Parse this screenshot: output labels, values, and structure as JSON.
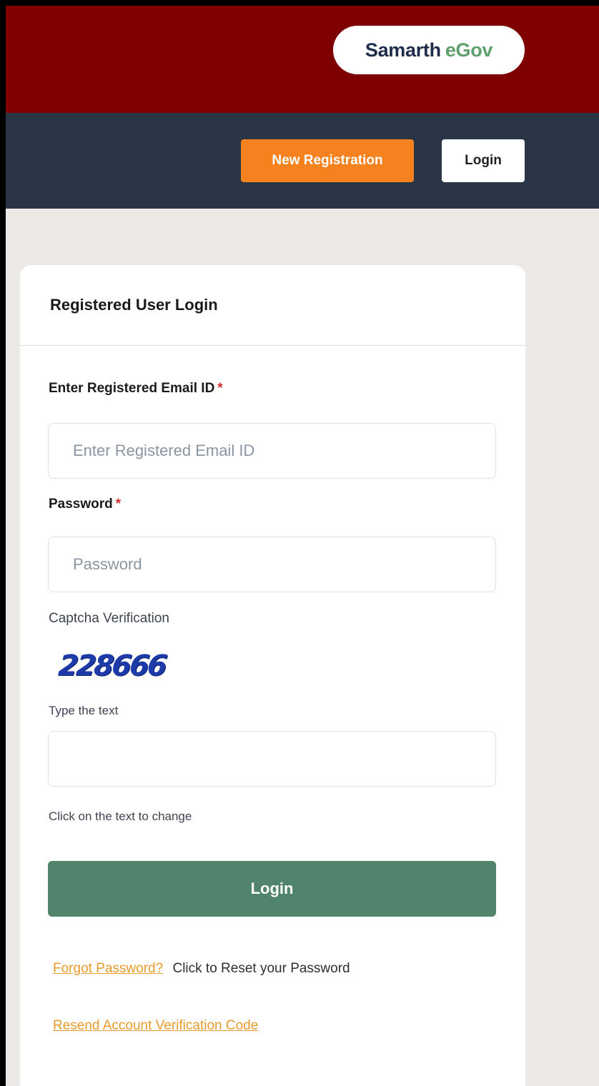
{
  "brand": {
    "part1": "Samarth",
    "part2": "eGov"
  },
  "nav": {
    "new_registration": "New Registration",
    "login": "Login"
  },
  "card": {
    "title": "Registered User Login",
    "email": {
      "label": "Enter Registered Email ID",
      "required_mark": "*",
      "placeholder": "Enter Registered Email ID",
      "value": ""
    },
    "password": {
      "label": "Password",
      "required_mark": "*",
      "placeholder": "Password",
      "value": ""
    },
    "captcha": {
      "heading": "Captcha Verification",
      "code": "228666",
      "input_label": "Type the text",
      "value": "",
      "hint": "Click on the text to change"
    },
    "submit_label": "Login",
    "forgot": {
      "link": "Forgot Password?",
      "text": "Click to Reset your Password"
    },
    "resend_link": "Resend Account Verification Code"
  },
  "colors": {
    "topbar": "#7f0000",
    "navbar": "#2a3546",
    "accent_orange": "#f5821f",
    "login_green": "#51846c",
    "link_orange": "#e89b2c",
    "required_red": "#d32f2f"
  }
}
